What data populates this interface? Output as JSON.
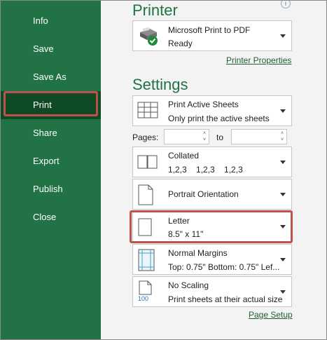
{
  "sidebar": {
    "items": [
      {
        "label": "Info"
      },
      {
        "label": "Save"
      },
      {
        "label": "Save As"
      },
      {
        "label": "Print"
      },
      {
        "label": "Share"
      },
      {
        "label": "Export"
      },
      {
        "label": "Publish"
      },
      {
        "label": "Close"
      }
    ],
    "active": "Print"
  },
  "printer": {
    "heading": "Printer",
    "name": "Microsoft Print to PDF",
    "status": "Ready",
    "properties_link": "Printer Properties"
  },
  "settings": {
    "heading": "Settings",
    "sheets": {
      "line1": "Print Active Sheets",
      "line2": "Only print the active sheets"
    },
    "pages": {
      "label": "Pages:",
      "to_label": "to",
      "from_value": "",
      "to_value": ""
    },
    "collation": {
      "line1": "Collated",
      "line2": "1,2,3    1,2,3    1,2,3"
    },
    "orientation": {
      "line1": "Portrait Orientation"
    },
    "paper": {
      "line1": "Letter",
      "line2": "8.5\" x 11\""
    },
    "margins": {
      "line1": "Normal Margins",
      "line2": "Top: 0.75\" Bottom: 0.75\" Lef..."
    },
    "scaling": {
      "line1": "No Scaling",
      "line2": "Print sheets at their actual size",
      "icon_text": "100"
    },
    "page_setup_link": "Page Setup"
  },
  "colors": {
    "sidebar_bg": "#217346",
    "sidebar_active": "#0e4a23",
    "highlight": "#c0504d",
    "heading": "#217346"
  }
}
